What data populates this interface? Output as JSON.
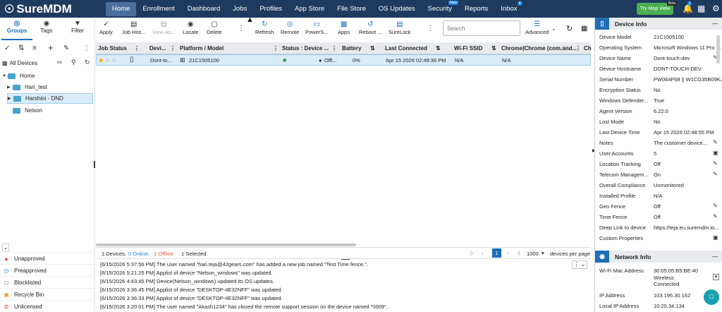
{
  "app": {
    "logo_text": "SureMDM"
  },
  "nav": {
    "items": [
      {
        "label": "Home"
      },
      {
        "label": "Enrollment"
      },
      {
        "label": "Dashboard"
      },
      {
        "label": "Jobs"
      },
      {
        "label": "Profiles"
      },
      {
        "label": "App Store"
      },
      {
        "label": "File Store"
      },
      {
        "label": "OS Updates"
      },
      {
        "label": "Security"
      },
      {
        "label": "Reports"
      },
      {
        "label": "Inbox"
      }
    ],
    "security_badge": "New",
    "inbox_badge": "8",
    "try_map_view": "Try Map View",
    "beta_badge": "Beta",
    "notification_badge": "1"
  },
  "left": {
    "tabs": [
      {
        "label": "Groups"
      },
      {
        "label": "Tags"
      },
      {
        "label": "Filter"
      }
    ],
    "all_devices": "All Devices",
    "tree": [
      {
        "label": "Home"
      },
      {
        "label": "Hari_test"
      },
      {
        "label": "Harshini - DND"
      },
      {
        "label": "Nelson"
      }
    ],
    "status_items": [
      {
        "label": "Unapproved"
      },
      {
        "label": "Preapproved"
      },
      {
        "label": "Blocklisted"
      },
      {
        "label": "Recycle Bin"
      },
      {
        "label": "Unlicensed"
      }
    ]
  },
  "toolbar": {
    "apply": "Apply",
    "job_history": "Job Hist...",
    "view_as": "View As...",
    "locate": "Locate",
    "delete": "Delete",
    "refresh": "Refresh",
    "remote": "Remote",
    "powershell": "PowerS...",
    "apps": "Apps",
    "reboot": "Reboot ...",
    "surelock": "SureLock",
    "search_placeholder": "Search",
    "advanced": "Advanced"
  },
  "grid": {
    "columns": [
      {
        "label": "Job Status"
      },
      {
        "label": "Devi..."
      },
      {
        "label": "Platform / Model"
      },
      {
        "label": "Status : Device ..."
      },
      {
        "label": "Battery"
      },
      {
        "label": "Last Connected"
      },
      {
        "label": "Wi-Fi SSID"
      },
      {
        "label": "Chrome|Chrome (com.and..."
      },
      {
        "label": "Ch"
      }
    ],
    "row": {
      "device_name": "Dont-to...",
      "model": "21C1505100",
      "status": "Offl...",
      "battery": "0%",
      "last_connected": "Apr 15 2026 02:49:36 PM",
      "wifi": "N/A",
      "chrome": "N/A"
    },
    "footer": {
      "devices": "1 Devices,",
      "online": "0 Online,",
      "offline": "1 Offline",
      "selected": "1 Selected",
      "page": "1",
      "per_page_value": "1000",
      "per_page_label": "devices per page"
    }
  },
  "logs": [
    "[6/15/2026 5:37:56 PM] The user named \"hari.teja@42gears.com\" has added a new job named \"Test Time fence.\".",
    "[6/15/2026 5:21:25 PM] Applist of device \"Nelson_windows\" was updated.",
    "[6/15/2026 4:43:45 PM] Device(Nelson_windows) updated its OS updates.",
    "[6/15/2026 3:36:45 PM] Applist of device \"DESKTOP-4E32NFF\" was updated.",
    "[6/15/2026 3:36:33 PM] Applist of device \"DESKTOP-4E32NFF\" was updated.",
    "[6/15/2026 3:20:01 PM] The user named \"Akash1234\" has closed the remote support session on the device named \"0009\"."
  ],
  "device_info": {
    "title": "Device Info",
    "fields": [
      {
        "key": "Device Model",
        "value": "21C1505100"
      },
      {
        "key": "Operating System",
        "value": "Microsoft Windows 11 Pro (..."
      },
      {
        "key": "Device Name",
        "value": "Dont-touch-dev"
      },
      {
        "key": "Device Hostname",
        "value": "DONT-TOUCH-DEV"
      },
      {
        "key": "Serial Number",
        "value": "PW064F68 || W1CG35B09KZ"
      },
      {
        "key": "Encryption Status",
        "value": "No"
      },
      {
        "key": "Windows Defender...",
        "value": "True"
      },
      {
        "key": "Agent Version",
        "value": "6.22.0"
      },
      {
        "key": "Lost Mode",
        "value": "No"
      },
      {
        "key": "Last Device Time",
        "value": "Apr 15 2026 02:48:55 PM"
      },
      {
        "key": "Notes",
        "value": "The customer device..."
      },
      {
        "key": "User Accounts",
        "value": "5"
      },
      {
        "key": "Location Tracking",
        "value": "Off"
      },
      {
        "key": "Telecom Managem...",
        "value": "On"
      },
      {
        "key": "Overall Compliance",
        "value": "Unmonitored"
      },
      {
        "key": "Installed Profile",
        "value": "N/A"
      },
      {
        "key": "Geo Fence",
        "value": "Off"
      },
      {
        "key": "Time Fence",
        "value": "Off"
      },
      {
        "key": "Deep Link to device",
        "value": "https://teja.eu.suremdm.io..."
      },
      {
        "key": "Custom Properties",
        "value": ""
      }
    ]
  },
  "network_info": {
    "title": "Network Info",
    "wifi_mac_label": "Wi-Fi Mac Address",
    "wifi_mac_value": "30:05:05:B5:BE:40",
    "wifi_mac_type": "Wireless",
    "wifi_mac_status": "Connected",
    "ip_label": "IP Address",
    "ip_value": "103.196.30.162",
    "local_ip_label": "Local IP Address",
    "local_ip_value": "10.20.34.134"
  },
  "colors": {
    "nav_bg": "#1f3a5f",
    "accent": "#1e6fb8",
    "offline": "#e05a3a",
    "online": "#1e88e5",
    "map_button": "#4caf50"
  }
}
